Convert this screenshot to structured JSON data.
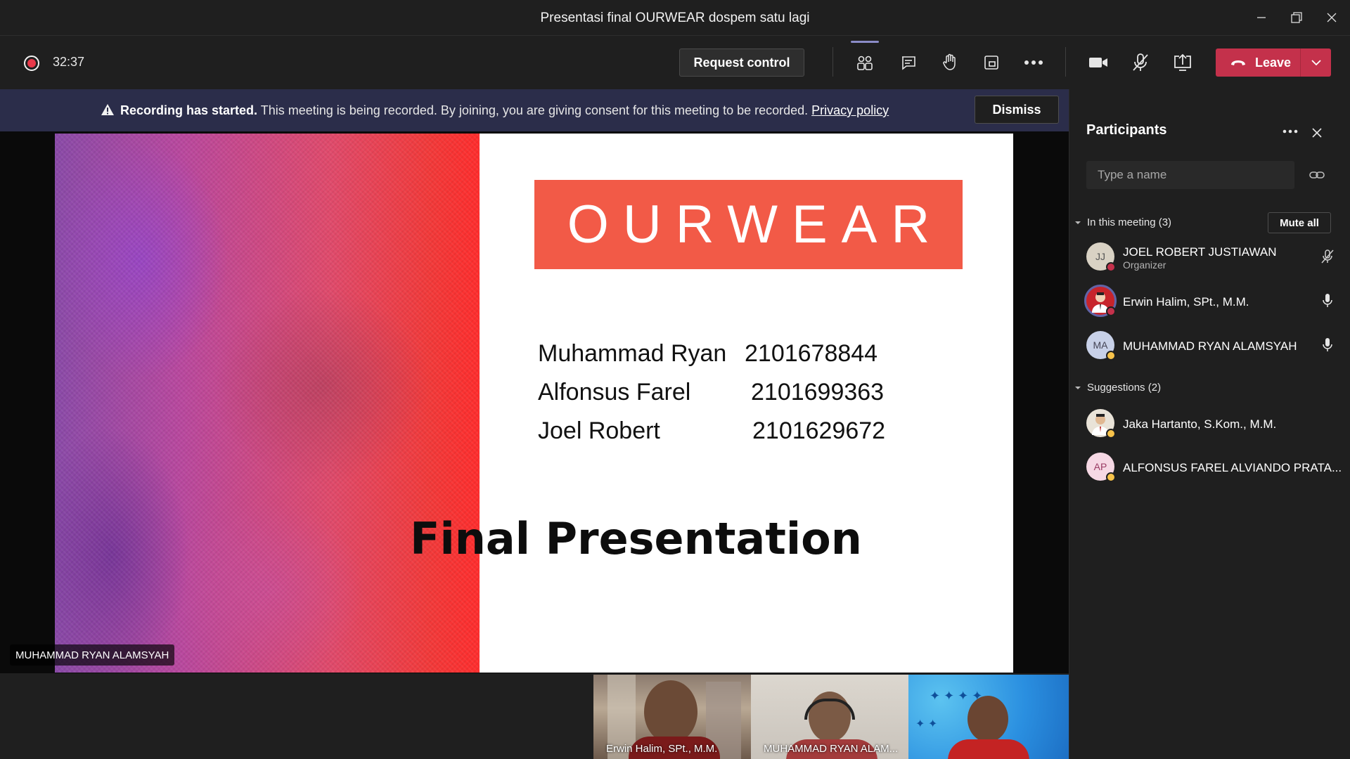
{
  "window": {
    "title": "Presentasi final OURWEAR dospem satu lagi"
  },
  "toolbar": {
    "timer": "32:37",
    "request_control": "Request control",
    "leave": "Leave",
    "icons": [
      "participants-icon",
      "chat-icon",
      "raise-hand-icon",
      "rooms-icon",
      "more-icon",
      "camera-icon",
      "mic-off-icon",
      "share-icon"
    ]
  },
  "banner": {
    "bold": "Recording has started.",
    "message": " This meeting is being recorded. By joining, you are giving consent for this meeting to be recorded. ",
    "link": "Privacy policy",
    "dismiss": "Dismiss"
  },
  "slide": {
    "logo": "OURWEAR",
    "members": [
      {
        "name": "Muhammad Ryan",
        "id": "2101678844"
      },
      {
        "name": "Alfonsus Farel",
        "id": "2101699363"
      },
      {
        "name": "Joel Robert",
        "id": "2101629672"
      }
    ],
    "title": "Final Presentation",
    "colors": {
      "logo_bg": "#f25a47",
      "paint_left": "#8a4aa8",
      "paint_right": "#ff2d2d"
    }
  },
  "stage": {
    "presenter_name": "MUHAMMAD RYAN ALAMSYAH"
  },
  "thumbnails": [
    {
      "label": "Erwin Halim, SPt., M.M."
    },
    {
      "label": "MUHAMMAD RYAN ALAM..."
    },
    {
      "label": ""
    }
  ],
  "panel": {
    "title": "Participants",
    "search_placeholder": "Type a name",
    "in_meeting": "In this meeting (3)",
    "mute_all": "Mute all",
    "participants": [
      {
        "initials": "JJ",
        "name": "JOEL ROBERT JUSTIAWAN",
        "role": "Organizer",
        "status": "busy",
        "mic": "muted"
      },
      {
        "initials": "",
        "name": "Erwin Halim, SPt., M.M.",
        "role": "",
        "status": "busy",
        "mic": "on"
      },
      {
        "initials": "MA",
        "name": "MUHAMMAD RYAN ALAMSYAH",
        "role": "",
        "status": "away",
        "mic": "on"
      }
    ],
    "suggestions": "Suggestions (2)",
    "suggested": [
      {
        "initials": "",
        "name": "Jaka Hartanto, S.Kom., M.M.",
        "status": "away"
      },
      {
        "initials": "AP",
        "name": "ALFONSUS FAREL ALVIANDO PRATA...",
        "status": "away"
      }
    ]
  }
}
